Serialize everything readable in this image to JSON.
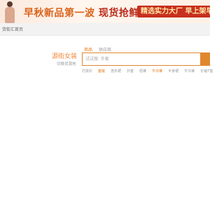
{
  "banner": {
    "headline_part1": "早秋新品第一波",
    "headline_part2": "现货抢鲜",
    "badge": "精选实力大厂  早上架早",
    "colors": {
      "orange": "#d9641c",
      "red": "#b92b1a",
      "badge_bg": "#c7301e"
    }
  },
  "nav": {
    "home_label": "货街汇首页"
  },
  "logo": {
    "title": "源街女装",
    "slogan": "切换货源地"
  },
  "search": {
    "tabs": [
      {
        "label": "商品",
        "active": true
      },
      {
        "label": "供应商",
        "active": false
      }
    ],
    "placeholder": "试试搜: 外套",
    "button_icon": "search-button",
    "accent_color": "#e0872e"
  },
  "hot_keywords": [
    {
      "label": "打底衫",
      "highlight": false
    },
    {
      "label": "套装",
      "highlight": true
    },
    {
      "label": "连衣裙",
      "highlight": false
    },
    {
      "label": "外套",
      "highlight": false
    },
    {
      "label": "短裤",
      "highlight": false
    },
    {
      "label": "牛仔裤",
      "highlight": true
    },
    {
      "label": "半身裙",
      "highlight": false
    },
    {
      "label": "牛仔裤",
      "highlight": false
    },
    {
      "label": "长袖T恤",
      "highlight": false
    }
  ]
}
